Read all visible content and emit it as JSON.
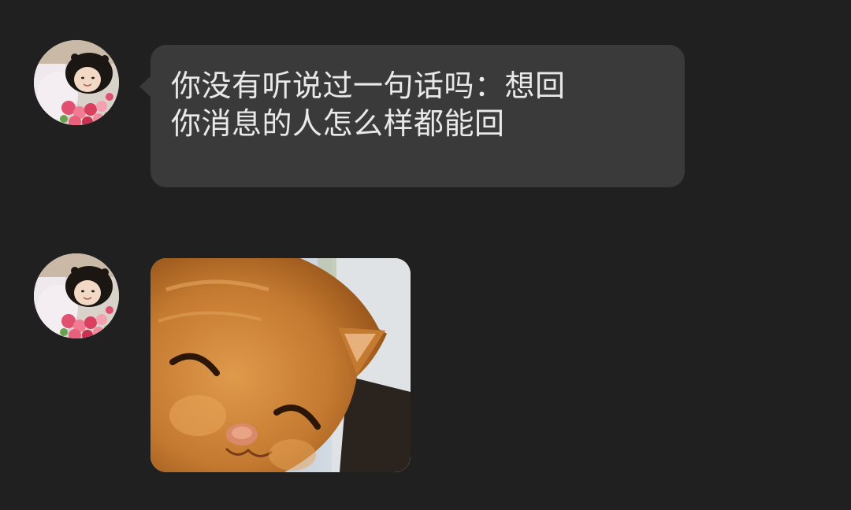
{
  "messages": [
    {
      "type": "text",
      "sender_avatar": "girl-with-flowers-avatar",
      "lines": [
        "你没有听说过一句话吗：想回",
        "你消息的人怎么样都能回"
      ]
    },
    {
      "type": "image",
      "sender_avatar": "girl-with-flowers-avatar",
      "image": "smiling-orange-cat-sticker"
    }
  ],
  "colors": {
    "background": "#202020",
    "bubble": "#3a3a3a",
    "bubble_text": "#e9e9e9"
  }
}
